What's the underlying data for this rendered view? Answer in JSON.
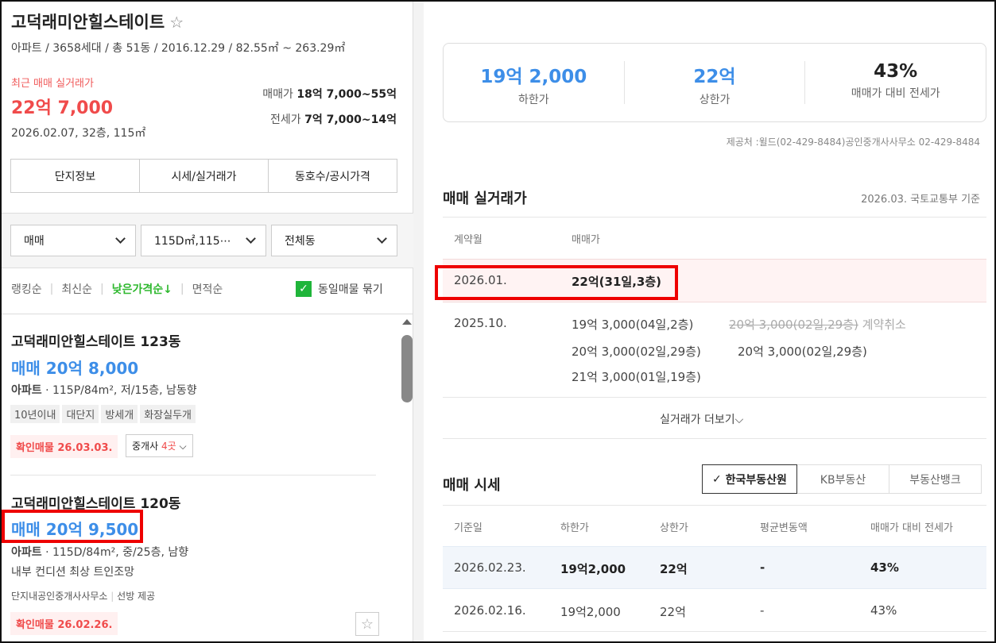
{
  "complex": {
    "name": "고덕래미안힐스테이트",
    "meta": "아파트 / 3658세대 / 총 51동 / 2016.12.29 / 82.55㎡ ~ 263.29㎡",
    "recent_label": "최근 매매 실거래가",
    "recent_price": "22억 7,000",
    "recent_sub": "2026.02.07, 32층, 115㎡",
    "sale_range_label": "매매가",
    "sale_range": "18억 7,000~55억",
    "jeonse_range_label": "전세가",
    "jeonse_range": "7억 7,000~14억"
  },
  "tabs": [
    "단지정보",
    "시세/실거래가",
    "동호수/공시가격"
  ],
  "filters": [
    "매매",
    "115D㎡,115⋯",
    "전체동"
  ],
  "sort": {
    "options": [
      "랭킹순",
      "최신순",
      "낮은가격순↓",
      "면적순"
    ],
    "active": 2,
    "group_same": "동일매물 묶기",
    "group_same_checked": true
  },
  "listings": [
    {
      "title": "고덕래미안힐스테이트 123동",
      "price": "매매 20억 8,000",
      "desc_type": "아파트",
      "desc": " · 115P/84m², 저/15층, 남동향",
      "tags": [
        "10년이내",
        "대단지",
        "방세개",
        "화장실두개"
      ],
      "confirmed": "확인매물 26.03.03.",
      "agent_prefix": "중개사 ",
      "agent_count": "4곳"
    },
    {
      "title": "고덕래미안힐스테이트 120동",
      "price": "매매 20억 9,500",
      "desc_type": "아파트",
      "desc": " · 115D/84m², 중/25층, 남향",
      "note": "내부 컨디션 최상 트인조망",
      "source": "단지내공인중개사사무소",
      "source2": "선방 제공",
      "confirmed": "확인매물 26.02.26."
    }
  ],
  "summary": [
    {
      "value": "19억 2,000",
      "label": "하한가"
    },
    {
      "value": "22억",
      "label": "상한가"
    },
    {
      "value": "43%",
      "label": "매매가 대비 전세가"
    }
  ],
  "provider": "제공처 :윌드(02-429-8484)공인중개사사무소 02-429-8484",
  "transactions": {
    "title": "매매 실거래가",
    "basis": "2026.03. 국토교통부 기준",
    "headers": [
      "계약월",
      "매매가"
    ],
    "rows": [
      {
        "month": "2026.01.",
        "deals": [
          "22억(31일,3층)"
        ]
      },
      {
        "month": "2025.10.",
        "deals": [
          "19억 3,000(04일,2층)",
          "20억 3,000(02일,29층)",
          "20억 3,000(02일,29층)",
          "21억 3,000(01일,19층)"
        ],
        "cancelled": "20억 3,000(02일,29층)",
        "cancelled_label": "계약취소"
      }
    ],
    "more": "실거래가 더보기"
  },
  "market": {
    "title": "매매 시세",
    "sources": [
      "한국부동산원",
      "KB부동산",
      "부동산뱅크"
    ],
    "active_source": 0,
    "headers": [
      "기준일",
      "하한가",
      "상한가",
      "평균변동액",
      "매매가 대비 전세가"
    ],
    "rows": [
      [
        "2026.02.23.",
        "19억2,000",
        "22억",
        "-",
        "43%"
      ],
      [
        "2026.02.16.",
        "19억2,000",
        "22억",
        "-",
        "43%"
      ]
    ]
  },
  "colors": {
    "accent_blue": "#3d8ee8",
    "red": "#f04b4b",
    "green": "#2eb82e",
    "highlight": "#ee0000"
  }
}
